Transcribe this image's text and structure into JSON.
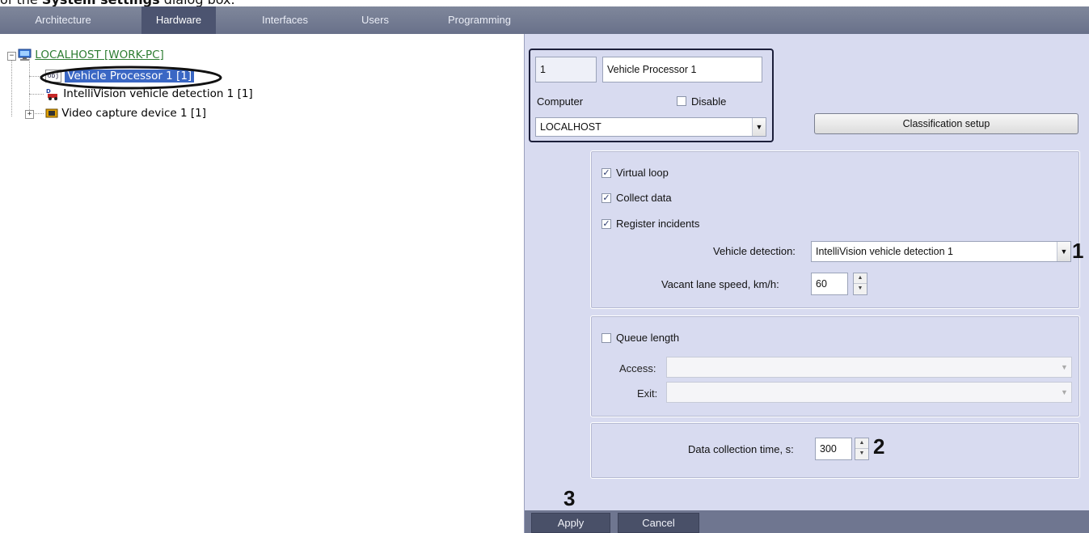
{
  "caption": {
    "prefix": "of the ",
    "bold": "System settings",
    "suffix": " dialog box."
  },
  "tabs": [
    {
      "label": "Architecture",
      "active": false
    },
    {
      "label": "Hardware",
      "active": true
    },
    {
      "label": "Interfaces",
      "active": false
    },
    {
      "label": "Users",
      "active": false
    },
    {
      "label": "Programming",
      "active": false
    }
  ],
  "tree": {
    "root": {
      "label": "LOCALHOST [WORK-PC]",
      "expander": "−"
    },
    "items": [
      {
        "label": "Vehicle Processor 1 [1]",
        "icon_text": "obj",
        "selected": true
      },
      {
        "label": "IntelliVision vehicle detection 1 [1]"
      },
      {
        "label": "Video capture device 1 [1]",
        "expander": "+"
      }
    ]
  },
  "object": {
    "id": "1",
    "name": "Vehicle Processor 1",
    "computer_label": "Computer",
    "disable_label": "Disable",
    "disable_checked": false,
    "computer_value": "LOCALHOST",
    "classification_button": "Classification setup"
  },
  "settings": {
    "virtual_loop": {
      "label": "Virtual loop",
      "checked": true
    },
    "collect_data": {
      "label": "Collect data",
      "checked": true
    },
    "register_incidents": {
      "label": "Register incidents",
      "checked": true
    },
    "vehicle_detection_label": "Vehicle detection:",
    "vehicle_detection_value": "IntelliVision vehicle detection 1",
    "vacant_speed_label": "Vacant lane speed, km/h:",
    "vacant_speed_value": "60"
  },
  "queue": {
    "label": "Queue length",
    "checked": false,
    "access_label": "Access:",
    "access_value": "",
    "exit_label": "Exit:",
    "exit_value": ""
  },
  "collection": {
    "label": "Data collection time, s:",
    "value": "300"
  },
  "markers": {
    "m1": "1",
    "m2": "2",
    "m3": "3"
  },
  "footer": {
    "apply": "Apply",
    "cancel": "Cancel"
  },
  "glyphs": {
    "check": "✓",
    "arrow_down": "▼",
    "arrow_up": "▲"
  },
  "colors": {
    "tree_root": "#2e7d32",
    "selection_bg": "#3a67c4",
    "panel_bg": "#d8dbf0"
  }
}
